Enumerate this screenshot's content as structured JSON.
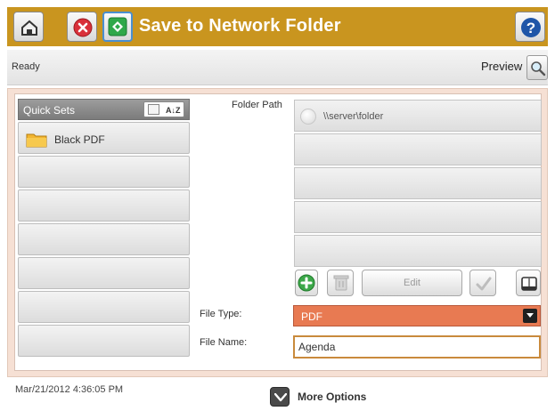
{
  "header": {
    "title": "Save to Network Folder",
    "icons": {
      "home": "home-icon",
      "stop": "stop-icon",
      "start": "start-icon",
      "help": "help-icon"
    },
    "colors": {
      "bar": "#c9951f",
      "stop": "#d9303a",
      "start": "#2fa84a",
      "help": "#1f56a8"
    }
  },
  "status": {
    "text": "Ready",
    "preview_label": "Preview"
  },
  "quick_sets": {
    "title": "Quick Sets",
    "sort_label": "A↓Z",
    "items": [
      "Black PDF",
      "",
      "",
      "",
      "",
      "",
      ""
    ]
  },
  "folder": {
    "label": "Folder Path",
    "rows": [
      "\\\\server\\folder",
      "",
      "",
      "",
      ""
    ],
    "edit_label": "Edit"
  },
  "file_type": {
    "label": "File Type:",
    "value": "PDF"
  },
  "file_name": {
    "label": "File Name:",
    "value": "Agenda"
  },
  "footer": {
    "datetime": "Mar/21/2012 4:36:05 PM",
    "more_label": "More Options"
  }
}
